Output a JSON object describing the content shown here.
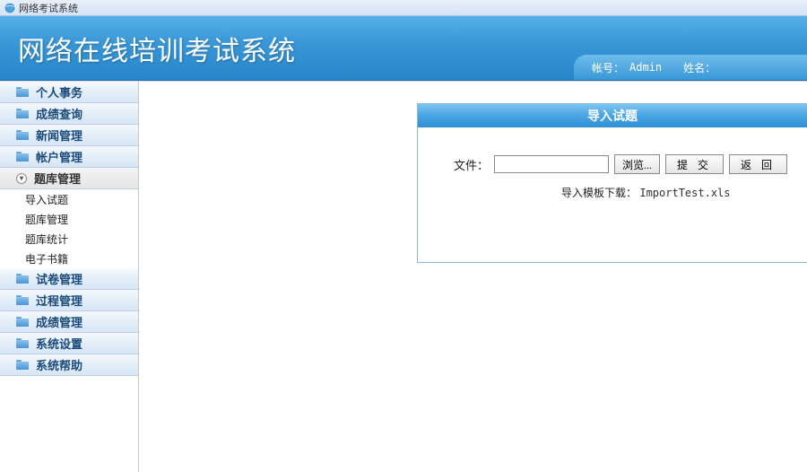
{
  "window": {
    "tab_title": "网络考试系统"
  },
  "header": {
    "title": "网络在线培训考试系统",
    "account_label": "帐号：",
    "account_value": "Admin",
    "name_label": "姓名："
  },
  "sidebar": {
    "items": [
      {
        "label": "个人事务",
        "sub": []
      },
      {
        "label": "成绩查询",
        "sub": []
      },
      {
        "label": "新闻管理",
        "sub": []
      },
      {
        "label": "帐户管理",
        "sub": []
      },
      {
        "label": "题库管理",
        "expanded": true,
        "sub": [
          {
            "label": "导入试题"
          },
          {
            "label": "题库管理"
          },
          {
            "label": "题库统计"
          },
          {
            "label": "电子书籍"
          }
        ]
      },
      {
        "label": "试卷管理",
        "sub": []
      },
      {
        "label": "过程管理",
        "sub": []
      },
      {
        "label": "成绩管理",
        "sub": []
      },
      {
        "label": "系统设置",
        "sub": []
      },
      {
        "label": "系统帮助",
        "sub": []
      }
    ]
  },
  "panel": {
    "title": "导入试题",
    "file_label": "文件：",
    "browse_label": "浏览...",
    "submit_label": "提 交",
    "back_label": "返 回",
    "template_label": "导入模板下载：",
    "template_file": "ImportTest.xls"
  }
}
